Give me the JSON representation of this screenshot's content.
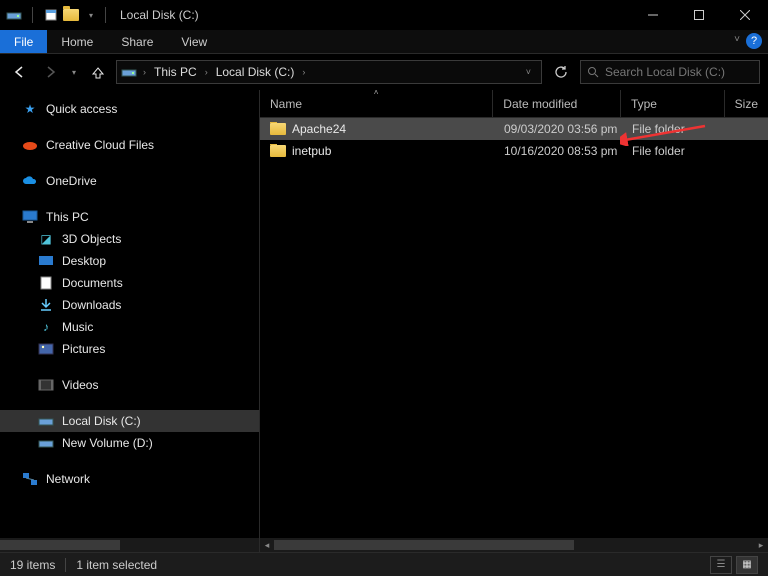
{
  "titlebar": {
    "title": "Local Disk (C:)"
  },
  "ribbon": {
    "file": "File",
    "tabs": [
      "Home",
      "Share",
      "View"
    ]
  },
  "nav": {
    "crumbs": [
      "This PC",
      "Local Disk (C:)"
    ],
    "search_placeholder": "Search Local Disk (C:)"
  },
  "sidebar": {
    "quick_access": "Quick access",
    "creative_cloud": "Creative Cloud Files",
    "onedrive": "OneDrive",
    "this_pc": "This PC",
    "pc_children": [
      "3D Objects",
      "Desktop",
      "Documents",
      "Downloads",
      "Music",
      "Pictures",
      "Videos"
    ],
    "drives": [
      "Local Disk (C:)",
      "New Volume (D:)"
    ],
    "network": "Network"
  },
  "columns": {
    "name": "Name",
    "date": "Date modified",
    "type": "Type",
    "size": "Size"
  },
  "rows": [
    {
      "name": "Apache24",
      "date": "09/03/2020 03:56 pm",
      "type": "File folder",
      "selected": true
    },
    {
      "name": "inetpub",
      "date": "10/16/2020 08:53 pm",
      "type": "File folder",
      "selected": false
    }
  ],
  "status": {
    "items": "19 items",
    "selected": "1 item selected"
  }
}
